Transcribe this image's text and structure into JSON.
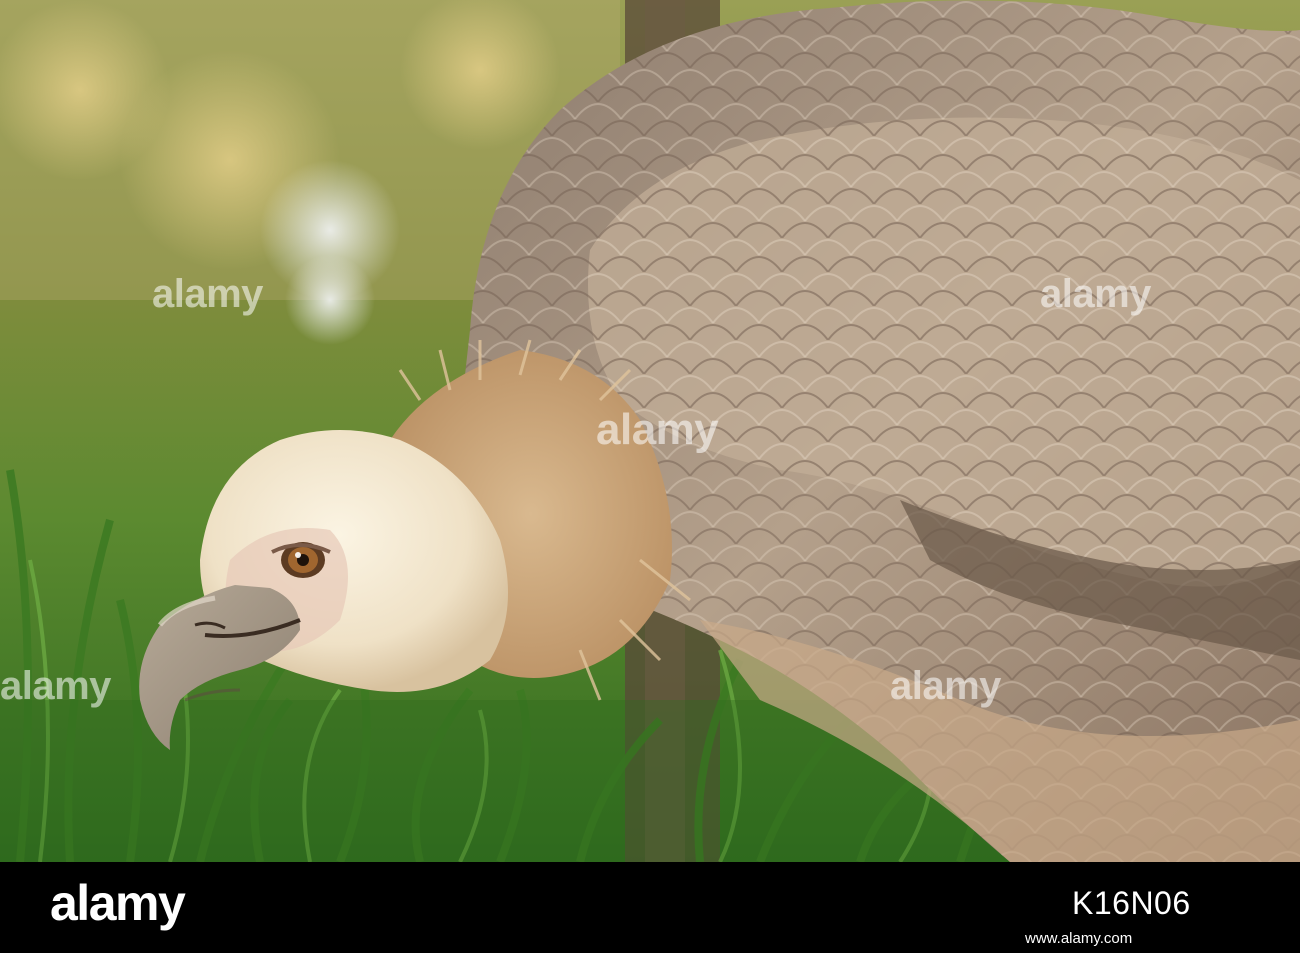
{
  "brand": {
    "logo_text": "alamy",
    "watermark_text": "alamy"
  },
  "footer": {
    "image_id": "K16N06",
    "url": "www.alamy.com"
  },
  "photo": {
    "subject_icon": "vulture-icon"
  },
  "colors": {
    "footer_bg": "#000000",
    "footer_text": "#ffffff",
    "foliage": "#4d8a2e",
    "plumage": "#a08a76",
    "head_down": "#f3e9d6"
  }
}
